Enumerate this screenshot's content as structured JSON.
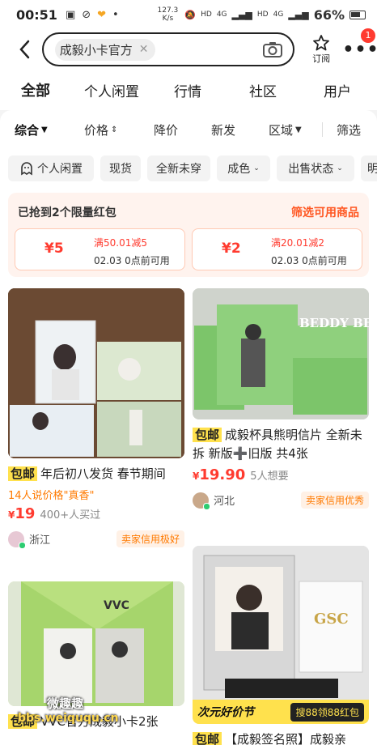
{
  "status_bar": {
    "time": "00:51",
    "network_speed": "127.3 K/s",
    "net_type_1": "HD",
    "net_type_2": "4G",
    "net_type_3": "HD",
    "net_type_4": "4G",
    "battery": "66%"
  },
  "header": {
    "search_query": "成毅小卡官方",
    "subscribe_label": "订阅",
    "more_badge": "1"
  },
  "tabs": [
    "全部",
    "个人闲置",
    "行情",
    "社区",
    "用户"
  ],
  "sort": {
    "items": [
      "综合",
      "价格",
      "降价",
      "新发",
      "区域",
      "筛选"
    ]
  },
  "filters": [
    "个人闲置",
    "现货",
    "全新未穿",
    "成色",
    "出售状态",
    "明"
  ],
  "coupons": {
    "title": "已抢到2个限量红包",
    "link": "筛选可用商品",
    "items": [
      {
        "amount": "¥5",
        "condition": "满50.01减5",
        "expiry": "02.03 0点前可用"
      },
      {
        "amount": "¥2",
        "condition": "满20.01减2",
        "expiry": "02.03 0点前可用"
      }
    ]
  },
  "products": [
    {
      "badge": "包邮",
      "title": "年后初八发货 春节期间",
      "says": "14人说价格\"真香\"",
      "price": "19",
      "want": "400+人买过",
      "location": "浙江",
      "rating": "卖家信用极好"
    },
    {
      "badge": "包邮",
      "title": "成毅杯具熊明信片 全新未拆 新版➕旧版 共4张",
      "price": "19.90",
      "want": "5人想要",
      "location": "河北",
      "rating": "卖家信用优秀",
      "image_text": "BEDDY BEAR"
    },
    {
      "badge": "包邮",
      "title": "VVC官方成毅小卡2张",
      "image_text": "VVC"
    },
    {
      "badge": "包邮",
      "title": "【成毅签名照】成毅亲",
      "image_text": "GSC",
      "banner_left": "次元好价节",
      "banner_right": "搜88领88红包"
    }
  ],
  "watermark": {
    "text": "微趣趣",
    "url": "bbs.weiququ.cn"
  },
  "colors": {
    "accent_yellow": "#ffe14d",
    "price_red": "#ff3b2f",
    "orange": "#ff7a00"
  }
}
